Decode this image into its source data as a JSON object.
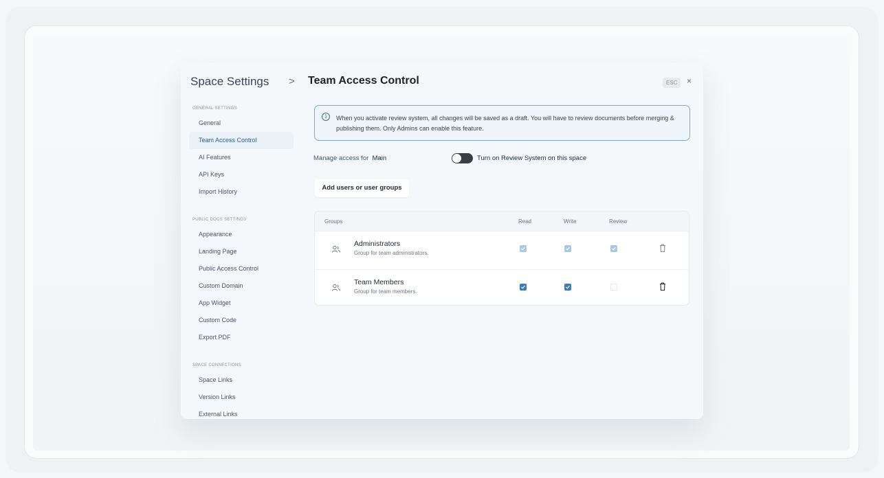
{
  "header": {
    "breadcrumb_root": "Space Settings",
    "breadcrumb_separator": ">",
    "title": "Team Access Control",
    "esc_label": "ESC",
    "close_label": "×"
  },
  "sidebar": {
    "sections": [
      {
        "label": "GENERAL SETTINGS",
        "items": [
          {
            "label": "General",
            "active": false
          },
          {
            "label": "Team Access Control",
            "active": true
          },
          {
            "label": "AI Features",
            "active": false
          },
          {
            "label": "API Keys",
            "active": false
          },
          {
            "label": "Import History",
            "active": false
          }
        ]
      },
      {
        "label": "PUBLIC DOCS SETTINGS",
        "items": [
          {
            "label": "Appearance",
            "active": false
          },
          {
            "label": "Landing Page",
            "active": false
          },
          {
            "label": "Public Access Control",
            "active": false
          },
          {
            "label": "Custom Domain",
            "active": false
          },
          {
            "label": "App Widget",
            "active": false
          },
          {
            "label": "Custom Code",
            "active": false
          },
          {
            "label": "Export PDF",
            "active": false
          }
        ]
      },
      {
        "label": "SPACE CONNECTIONS",
        "items": [
          {
            "label": "Space Links",
            "active": false
          },
          {
            "label": "Version Links",
            "active": false
          },
          {
            "label": "External Links",
            "active": false
          }
        ]
      }
    ]
  },
  "info": {
    "icon": "info-icon",
    "text": "When you activate review system, all changes will be saved as a draft. You will have to review documents before merging & publishing them. Only Admins can enable this feature."
  },
  "manage": {
    "label": "Manage access for",
    "space": "Main",
    "toggle_label": "Turn on Review System on this space",
    "toggle_on": false
  },
  "add_button": "Add users or user groups",
  "table": {
    "columns": [
      "Groups",
      "Read",
      "Write",
      "Review"
    ],
    "rows": [
      {
        "name": "Administrators",
        "description": "Group for team administrators.",
        "read": "checked-disabled",
        "write": "checked-disabled",
        "review": "checked-disabled"
      },
      {
        "name": "Team Members",
        "description": "Group for team members.",
        "read": "checked",
        "write": "checked",
        "review": "unchecked"
      }
    ]
  },
  "colors": {
    "accent": "#3b7bc0",
    "info_border": "#7fa9d1",
    "active_item_bg": "#eaf1f7"
  }
}
